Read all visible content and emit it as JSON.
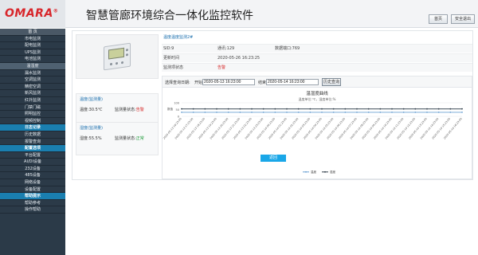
{
  "header": {
    "logo": "OMARA",
    "logo_mark": "®",
    "title": "智慧管廊环境综合一体化监控软件",
    "home_btn": "首页",
    "exit_btn": "安全退出"
  },
  "sidebar": {
    "items": [
      {
        "label": "首 页",
        "kind": "header"
      },
      {
        "label": "市电监测",
        "kind": "item"
      },
      {
        "label": "配电监测",
        "kind": "item"
      },
      {
        "label": "UPS监测",
        "kind": "item"
      },
      {
        "label": "电池监测",
        "kind": "item"
      },
      {
        "label": "温湿度",
        "kind": "active"
      },
      {
        "label": "漏水监测",
        "kind": "item"
      },
      {
        "label": "空调监测",
        "kind": "item"
      },
      {
        "label": "精密空调",
        "kind": "item"
      },
      {
        "label": "新风监测",
        "kind": "item"
      },
      {
        "label": "红外监测",
        "kind": "item"
      },
      {
        "label": "门禁门磁",
        "kind": "item"
      },
      {
        "label": "照明监控",
        "kind": "item"
      },
      {
        "label": "视频控制",
        "kind": "item"
      },
      {
        "label": "日志记录",
        "kind": "section"
      },
      {
        "label": "历史数据",
        "kind": "item"
      },
      {
        "label": "报警查询",
        "kind": "item"
      },
      {
        "label": "配置选项",
        "kind": "section"
      },
      {
        "label": "平台配置",
        "kind": "item"
      },
      {
        "label": "AI/DI设备",
        "kind": "item"
      },
      {
        "label": "232设备",
        "kind": "item"
      },
      {
        "label": "485设备",
        "kind": "item"
      },
      {
        "label": "网络设备",
        "kind": "item"
      },
      {
        "label": "设备配置",
        "kind": "item"
      },
      {
        "label": "帮助提示",
        "kind": "section"
      },
      {
        "label": "帮助参考",
        "kind": "item"
      },
      {
        "label": "操作帮助",
        "kind": "item"
      }
    ]
  },
  "sensors": [
    {
      "title": "温度(监测量)",
      "value": "温度:30.5℃",
      "status_label": "监测量状态:",
      "status": "告警",
      "status_kind": "alarm"
    },
    {
      "title": "湿度(监测量)",
      "value": "湿度:55.5%",
      "status_label": "监测量状态:",
      "status": "正常",
      "status_kind": "ok"
    }
  ],
  "info": {
    "title": "温度温度监测2#",
    "sid": "SID:9",
    "address": "通讯:129",
    "port": "数据端口:769",
    "update_label": "更新时间",
    "update_time": "2020-05-26 16:23:25",
    "state_label": "监测项状态",
    "state_value": "告警"
  },
  "query": {
    "label": "选择查询日期:",
    "start_label": "开始",
    "start_value": "2020-05-13 16:23:00",
    "end_label": "结束",
    "end_value": "2020-05-14 16:23:00",
    "button": "历史查询"
  },
  "back_button": "返回",
  "chart_data": {
    "type": "line",
    "title": "温湿度曲线",
    "subtitle": "温度单位:℃，湿度单位:%",
    "ylabel": "数值",
    "ylim": [
      0,
      100
    ],
    "yticks": [
      "100",
      "50",
      "0"
    ],
    "x": [
      "2020-05-13 16:23:00",
      "2020-05-13 17:23:00",
      "2020-05-13 18:23:00",
      "2020-05-13 19:23:00",
      "2020-05-13 20:23:00",
      "2020-05-13 21:23:00",
      "2020-05-13 22:23:00",
      "2020-05-13 23:23:00",
      "2020-05-14 00:23:00",
      "2020-05-14 01:23:00",
      "2020-05-14 02:23:00",
      "2020-05-14 03:23:00",
      "2020-05-14 04:23:00",
      "2020-05-14 05:23:00",
      "2020-05-14 06:23:00",
      "2020-05-14 07:23:00",
      "2020-05-14 08:23:00",
      "2020-05-14 09:23:00",
      "2020-05-14 10:23:00",
      "2020-05-14 11:23:00",
      "2020-05-14 12:23:00",
      "2020-05-14 13:23:00",
      "2020-05-14 14:23:00",
      "2020-05-14 15:23:00",
      "2020-05-14 16:23:00"
    ],
    "series": [
      {
        "name": "温度",
        "color": "#6aa0d2",
        "values": [
          30,
          30,
          30,
          30,
          30,
          30,
          30,
          30,
          30,
          30,
          30,
          30,
          30,
          30,
          30,
          30,
          30,
          30,
          30,
          30,
          30,
          30,
          30,
          30,
          30
        ]
      },
      {
        "name": "湿度",
        "color": "#2f3d4a",
        "values": [
          55,
          55,
          55,
          55,
          55,
          55,
          55,
          55,
          55,
          55,
          55,
          55,
          55,
          55,
          55,
          55,
          55,
          55,
          55,
          55,
          55,
          55,
          55,
          55,
          55
        ]
      }
    ],
    "grid": true,
    "legend_position": "bottom"
  }
}
